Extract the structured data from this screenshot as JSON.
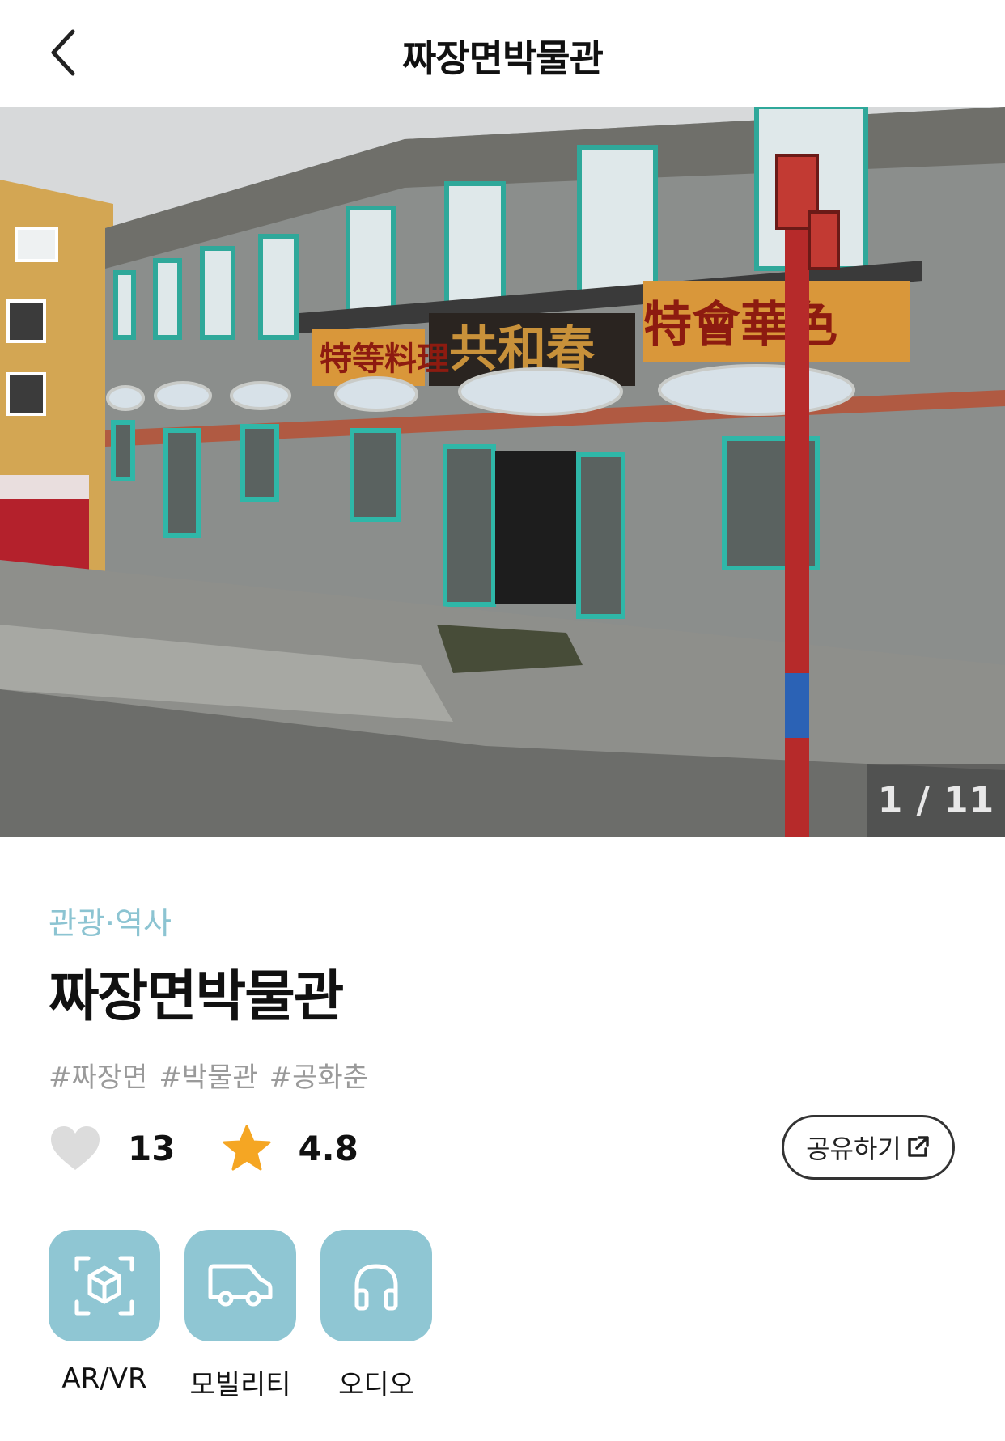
{
  "header": {
    "title": "짜장면박물관"
  },
  "gallery": {
    "counter": "1 / 11",
    "current": 1,
    "total": 11
  },
  "place": {
    "category": "관광·역사",
    "title": "짜장면박물관",
    "tags": [
      "#짜장면",
      "#박물관",
      "#공화춘"
    ],
    "likes": "13",
    "rating": "4.8"
  },
  "actions": {
    "share_label": "공유하기"
  },
  "features": [
    {
      "label": "AR/VR",
      "icon": "ar-cube-icon"
    },
    {
      "label": "모빌리티",
      "icon": "van-icon"
    },
    {
      "label": "오디오",
      "icon": "headphones-icon"
    }
  ],
  "colors": {
    "accent": "#8fc6d3",
    "category_text": "#8cc4d2",
    "star": "#f5a623",
    "heart": "#dcdcdc"
  }
}
